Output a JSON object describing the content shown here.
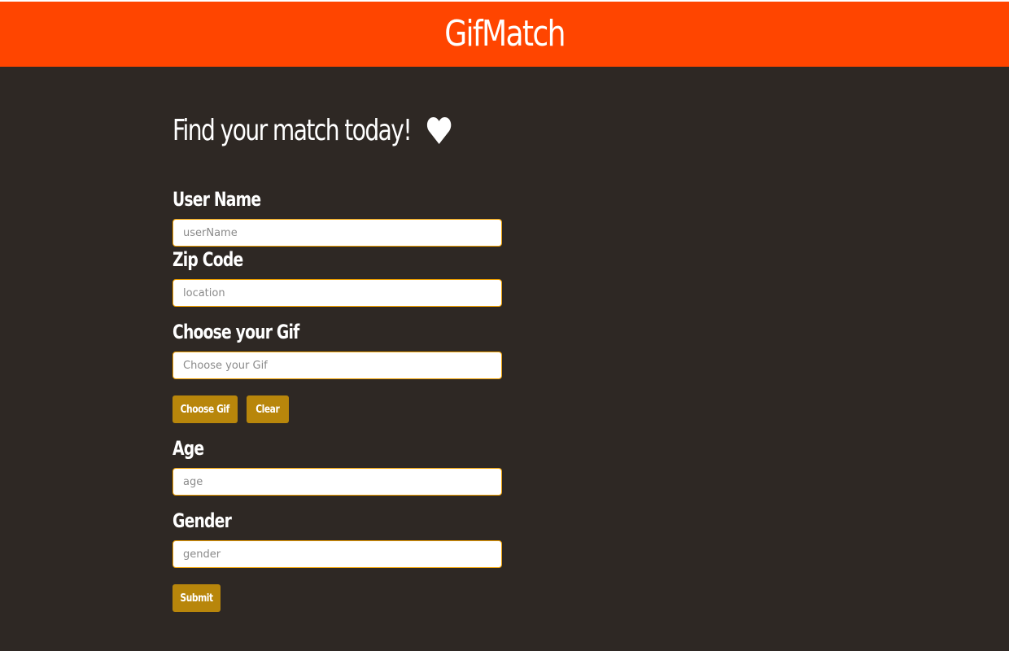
{
  "header": {
    "title": "GifMatch",
    "background_color": "#ff4500"
  },
  "page": {
    "heading": "Find your match today!",
    "heading_icon": "heart-icon",
    "background_color": "#2e2824"
  },
  "form": {
    "username": {
      "label": "User Name",
      "placeholder": "userName",
      "value": ""
    },
    "zip": {
      "label": "Zip Code",
      "placeholder": "location",
      "value": ""
    },
    "gif": {
      "label": "Choose your Gif",
      "placeholder": "Choose your Gif",
      "value": ""
    },
    "choose_gif_button": "Choose Gif",
    "clear_button": "Clear",
    "age": {
      "label": "Age",
      "placeholder": "age",
      "value": ""
    },
    "gender": {
      "label": "Gender",
      "placeholder": "gender",
      "value": ""
    },
    "submit_button": "Submit",
    "button_color": "#b8860b",
    "input_border_color": "#f0a000"
  }
}
